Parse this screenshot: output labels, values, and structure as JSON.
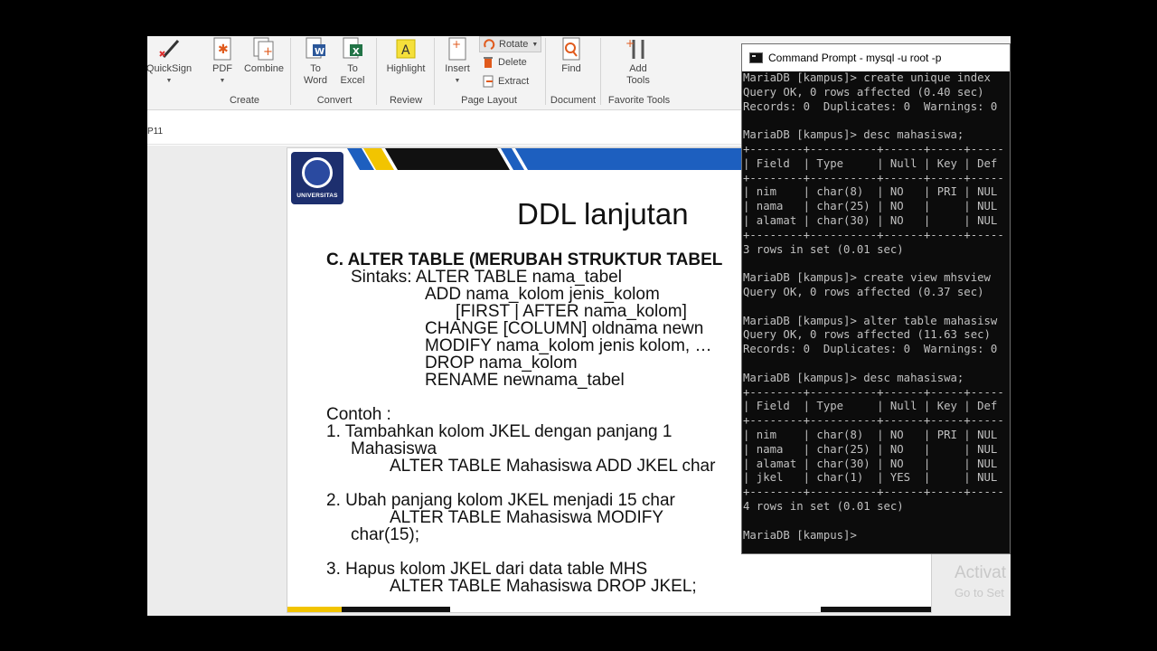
{
  "ribbon": {
    "buttons": [
      {
        "label": "QuickSign",
        "icon": "pen-icon"
      },
      {
        "label": "PDF",
        "icon": "pdf-create-icon"
      },
      {
        "label": "Combine",
        "icon": "combine-icon"
      },
      {
        "label": "To Word",
        "icon": "word-icon"
      },
      {
        "label": "To Excel",
        "icon": "excel-icon"
      },
      {
        "label": "Highlight",
        "icon": "highlight-icon"
      },
      {
        "label": "Insert",
        "icon": "insert-page-icon"
      },
      {
        "label": "Find",
        "icon": "find-icon"
      },
      {
        "label": "Add Tools",
        "icon": "tools-icon"
      }
    ],
    "small_buttons": [
      "Rotate",
      "Delete",
      "Extract"
    ],
    "groups": [
      "Create",
      "Convert",
      "Review",
      "Page Layout",
      "Document",
      "Favorite Tools"
    ]
  },
  "page_ref": "P11",
  "slide": {
    "logo_text": "UNIVERSITAS",
    "title": "DDL lanjutan",
    "heading": "C. ALTER TABLE (MERUBAH STRUKTUR TABEL",
    "lines": [
      "Sintaks: ALTER TABLE nama_tabel",
      "ADD  nama_kolom   jenis_kolom",
      "[FIRST | AFTER nama_kolom]",
      "CHANGE [COLUMN]    oldnama    newn",
      "MODIFY  nama_kolom   jenis kolom, …",
      "DROP  nama_kolom",
      "RENAME  newnama_tabel",
      "Contoh :",
      "1.  Tambahkan  kolom  JKEL  dengan  panjang  1",
      "Mahasiswa",
      "ALTER TABLE Mahasiswa ADD  JKEL char",
      "2.  Ubah panjang kolom JKEL menjadi 15 char",
      "ALTER     TABLE  Mahasiswa     MODIFY",
      "char(15);",
      "3.  Hapus kolom JKEL dari data table MHS",
      "ALTER  TABLE  Mahasiswa  DROP JKEL;"
    ]
  },
  "watermark": {
    "line1": "Activat",
    "line2": "Go to Set"
  },
  "cmd": {
    "title": "Command Prompt - mysql  -u root -p",
    "lines": [
      "MariaDB [kampus]> create unique index",
      "Query OK, 0 rows affected (0.40 sec)",
      "Records: 0  Duplicates: 0  Warnings: 0",
      "",
      "MariaDB [kampus]> desc mahasiswa;",
      "+--------+----------+------+-----+-----",
      "| Field  | Type     | Null | Key | Def",
      "+--------+----------+------+-----+-----",
      "| nim    | char(8)  | NO   | PRI | NUL",
      "| nama   | char(25) | NO   |     | NUL",
      "| alamat | char(30) | NO   |     | NUL",
      "+--------+----------+------+-----+-----",
      "3 rows in set (0.01 sec)",
      "",
      "MariaDB [kampus]> create view mhsview",
      "Query OK, 0 rows affected (0.37 sec)",
      "",
      "MariaDB [kampus]> alter table mahasisw",
      "Query OK, 0 rows affected (11.63 sec)",
      "Records: 0  Duplicates: 0  Warnings: 0",
      "",
      "MariaDB [kampus]> desc mahasiswa;",
      "+--------+----------+------+-----+-----",
      "| Field  | Type     | Null | Key | Def",
      "+--------+----------+------+-----+-----",
      "| nim    | char(8)  | NO   | PRI | NUL",
      "| nama   | char(25) | NO   |     | NUL",
      "| alamat | char(30) | NO   |     | NUL",
      "| jkel   | char(1)  | YES  |     | NUL",
      "+--------+----------+------+-----+-----",
      "4 rows in set (0.01 sec)",
      "",
      "MariaDB [kampus]>"
    ]
  }
}
